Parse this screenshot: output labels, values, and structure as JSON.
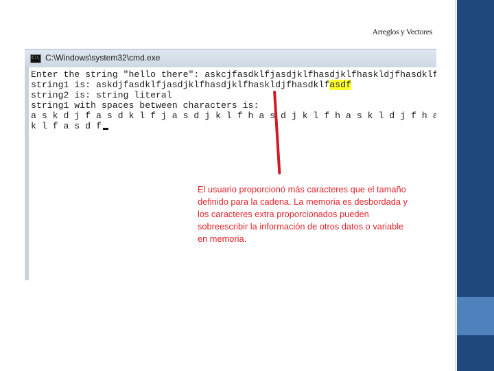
{
  "slide": {
    "title": "Arreglos y Vectores"
  },
  "window": {
    "title": "C:\\Windows\\system32\\cmd.exe",
    "icon": "cmd-icon"
  },
  "console": {
    "lines": [
      "Enter the string \"hello there\": askcjfasdklfjasdjklfhasdjklfhaskldjfhasdklfasdf",
      "string1 is: askdjfasdklfjasdjklfhasdjklfhaskldjfhasdklf",
      "string2 is: string literal",
      "string1 with spaces between characters is:",
      "a s k d j f a s d k l f j a s d j k l f h a s d j k l f h a s k l d j f h a s d",
      "k l f a s d f"
    ],
    "highlighted_suffix": "asdf"
  },
  "annotation": {
    "text": "El usuario proporcionó más caracteres que el tamaño definido para la cadena. La memoria es desbordada y los caracteres extra proporcionados pueden sobreescribir la información de otros datos o variable en memoria."
  },
  "colors": {
    "annotation": "#e0232b",
    "highlight": "#ffff2e",
    "sidebar": "#1f497d",
    "sidebar_accent": "#4f81bd"
  }
}
